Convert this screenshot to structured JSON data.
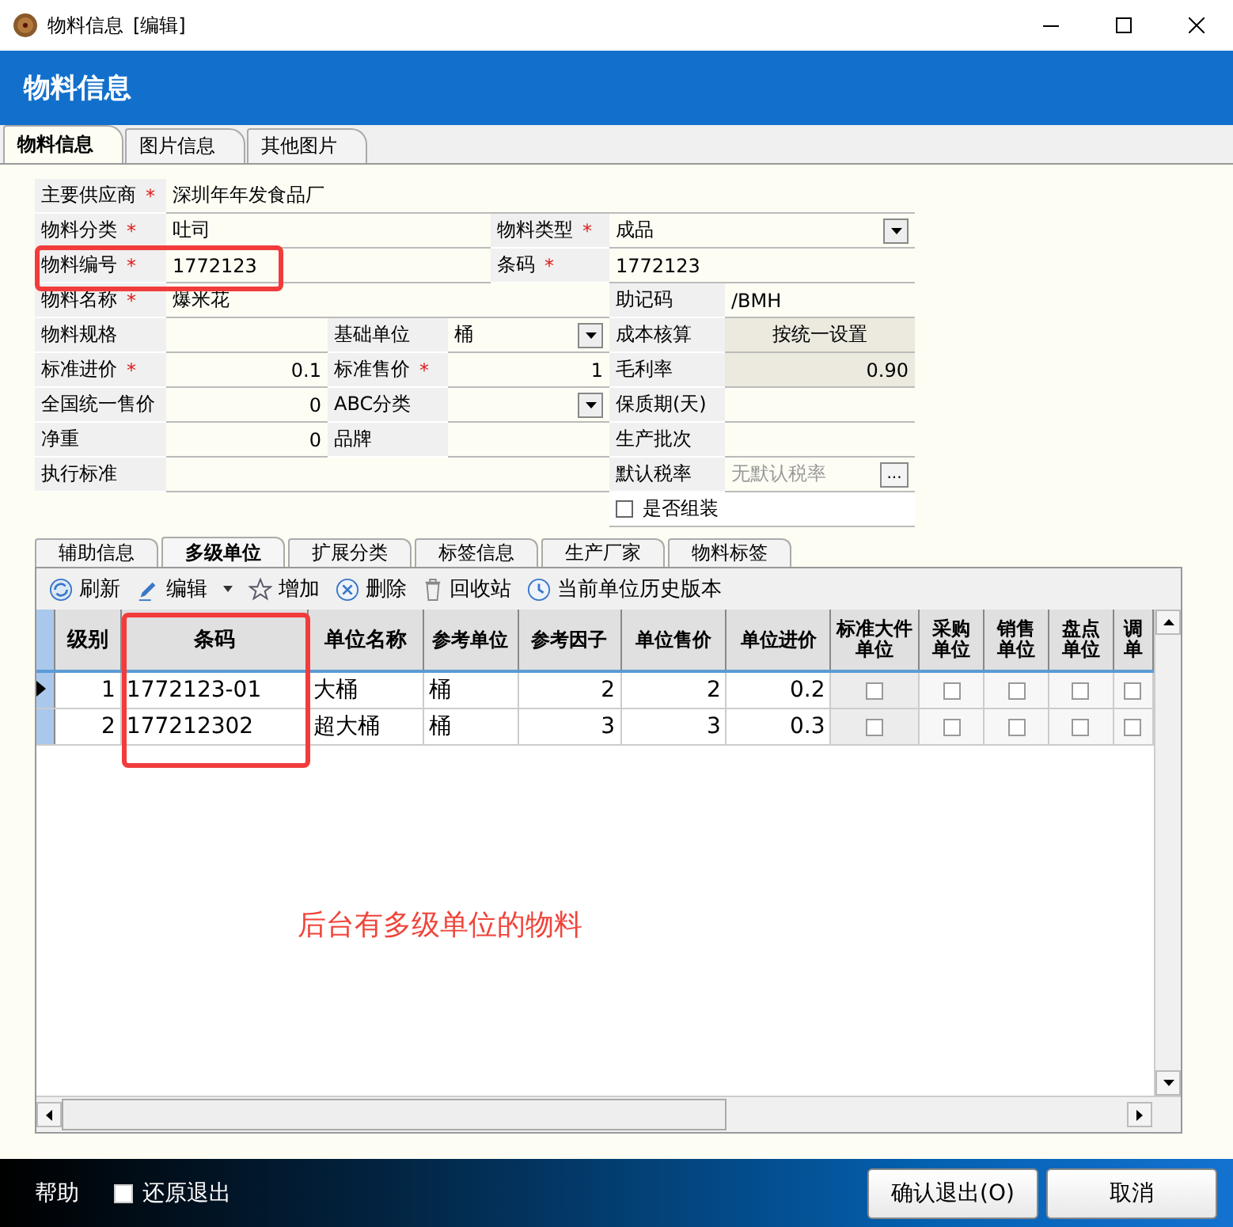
{
  "window": {
    "title": "物料信息",
    "mode": "[编辑]"
  },
  "header": {
    "title": "物料信息"
  },
  "tabs": [
    {
      "label": "物料信息",
      "selected": true
    },
    {
      "label": "图片信息",
      "selected": false
    },
    {
      "label": "其他图片",
      "selected": false
    }
  ],
  "form": {
    "rows": [
      [
        {
          "kind": "label",
          "text": "主要供应商",
          "mark": "*"
        },
        {
          "kind": "value",
          "text": "深圳年年发食品厂"
        }
      ],
      [
        {
          "kind": "label",
          "text": "物料分类",
          "mark": "*"
        },
        {
          "kind": "value",
          "text": "吐司"
        },
        {
          "kind": "label",
          "text": "物料类型",
          "mark": "*"
        },
        {
          "kind": "select",
          "text": "成品"
        }
      ],
      [
        {
          "kind": "label",
          "text": "物料编号",
          "mark": "*"
        },
        {
          "kind": "value",
          "text": "1772123"
        },
        {
          "kind": "label",
          "text": "条码",
          "mark": "*"
        },
        {
          "kind": "value",
          "text": "1772123"
        }
      ],
      [
        {
          "kind": "label",
          "text": "物料名称",
          "mark": "*"
        },
        {
          "kind": "value",
          "text": "爆米花"
        },
        {
          "kind": "label",
          "text": "助记码"
        },
        {
          "kind": "value",
          "text": "/BMH"
        }
      ],
      [
        {
          "kind": "label",
          "text": "物料规格"
        },
        {
          "kind": "value"
        },
        {
          "kind": "label",
          "text": "基础单位"
        },
        {
          "kind": "select",
          "text": "桶"
        },
        {
          "kind": "label",
          "text": "成本核算"
        },
        {
          "kind": "readonly",
          "text": "按统一设置"
        }
      ],
      [
        {
          "kind": "label",
          "text": "标准进价",
          "mark": "*"
        },
        {
          "kind": "number",
          "text": "0.1"
        },
        {
          "kind": "label",
          "text": "标准售价",
          "mark": "*"
        },
        {
          "kind": "number",
          "text": "1"
        },
        {
          "kind": "label",
          "text": "毛利率"
        },
        {
          "kind": "readonly_number",
          "text": "0.90"
        }
      ],
      [
        {
          "kind": "label",
          "text": "全国统一售价"
        },
        {
          "kind": "number",
          "text": "0"
        },
        {
          "kind": "label",
          "text": "ABC分类"
        },
        {
          "kind": "select"
        },
        {
          "kind": "label",
          "text": "保质期(天)"
        },
        {
          "kind": "value"
        }
      ],
      [
        {
          "kind": "label",
          "text": "净重"
        },
        {
          "kind": "number",
          "text": "0"
        },
        {
          "kind": "label",
          "text": "品牌"
        },
        {
          "kind": "value"
        },
        {
          "kind": "label",
          "text": "生产批次"
        },
        {
          "kind": "value"
        }
      ],
      [
        {
          "kind": "label",
          "text": "执行标准"
        },
        {
          "kind": "value"
        },
        {
          "kind": "label",
          "text": "默认税率"
        },
        {
          "kind": "picker",
          "placeholder": "无默认税率",
          "button": "..."
        }
      ],
      [
        {
          "kind": "blank"
        },
        {
          "kind": "blank"
        },
        {
          "kind": "blank"
        },
        {
          "kind": "blank"
        },
        {
          "kind": "checkbox",
          "label": "是否组装",
          "checked": false
        }
      ]
    ]
  },
  "sub_tabs": [
    {
      "label": "辅助信息",
      "selected": false
    },
    {
      "label": "多级单位",
      "selected": true
    },
    {
      "label": "扩展分类",
      "selected": false
    },
    {
      "label": "标签信息",
      "selected": false
    },
    {
      "label": "生产厂家",
      "selected": false
    },
    {
      "label": "物料标签",
      "selected": false
    }
  ],
  "toolbar": [
    {
      "kind": "refresh",
      "label": "刷新"
    },
    {
      "kind": "edit",
      "label": "编辑"
    },
    {
      "kind": "add",
      "label": "增加"
    },
    {
      "kind": "delete",
      "label": "删除"
    },
    {
      "kind": "recycle",
      "label": "回收站"
    },
    {
      "kind": "history",
      "label": "当前单位历史版本"
    }
  ],
  "table": {
    "columns": [
      {
        "label": "级别"
      },
      {
        "label": "条码"
      },
      {
        "label": "单位名称"
      },
      {
        "label": "参考单位"
      },
      {
        "label": "参考因子"
      },
      {
        "label": "单位售价"
      },
      {
        "label": "单位进价"
      },
      {
        "label": "标准大件单位"
      },
      {
        "label": "采购单位"
      },
      {
        "label": "销售单位"
      },
      {
        "label": "盘点单位"
      },
      {
        "label": "调单"
      }
    ],
    "rows": [
      {
        "current": true,
        "cells": [
          "1",
          "1772123-01",
          "大桶",
          "桶",
          "2",
          "2",
          "0.2"
        ],
        "flags": [
          false,
          false,
          false,
          false,
          false
        ]
      },
      {
        "current": false,
        "cells": [
          "2",
          "177212302",
          "超大桶",
          "桶",
          "3",
          "3",
          "0.3"
        ],
        "flags": [
          false,
          false,
          false,
          false,
          false
        ]
      }
    ]
  },
  "annotation": "后台有多级单位的物料",
  "footer": {
    "help": "帮助",
    "restore": {
      "label": "还原退出",
      "checked": false
    },
    "buttons": [
      "确认退出(O)",
      "取消"
    ]
  }
}
